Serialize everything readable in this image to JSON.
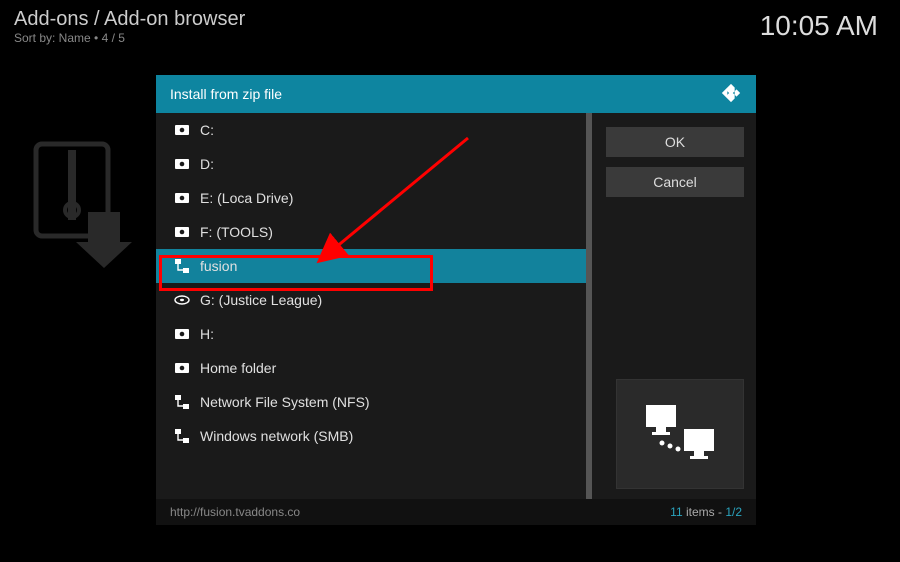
{
  "header": {
    "breadcrumb": "Add-ons / Add-on browser",
    "sort": "Sort by: Name  •  4 / 5"
  },
  "clock": "10:05 AM",
  "dialog": {
    "title": "Install from zip file",
    "buttons": {
      "ok": "OK",
      "cancel": "Cancel"
    },
    "items": [
      {
        "icon": "disc",
        "label": "C:"
      },
      {
        "icon": "disc",
        "label": "D:"
      },
      {
        "icon": "disc",
        "label": "E: (Loca Drive)"
      },
      {
        "icon": "disc",
        "label": "F: (TOOLS)"
      },
      {
        "icon": "net",
        "label": "fusion",
        "selected": true
      },
      {
        "icon": "bd",
        "label": "G: (Justice League)"
      },
      {
        "icon": "disc",
        "label": "H:"
      },
      {
        "icon": "disc",
        "label": "Home folder"
      },
      {
        "icon": "net",
        "label": "Network File System (NFS)"
      },
      {
        "icon": "net",
        "label": "Windows network (SMB)"
      }
    ],
    "footer": {
      "path": "http://fusion.tvaddons.co",
      "count_num": "11",
      "count_word": " items - ",
      "page": "1/2"
    }
  }
}
